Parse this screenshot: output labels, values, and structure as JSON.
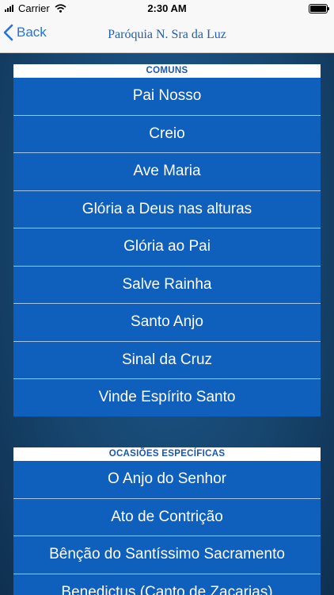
{
  "status_bar": {
    "carrier": "Carrier",
    "time": "2:30 AM"
  },
  "nav": {
    "back_label": "Back",
    "title": "Paróquia N. Sra da Luz"
  },
  "sections": [
    {
      "header": "COMUNS",
      "items": [
        "Pai Nosso",
        "Creio",
        "Ave Maria",
        "Glória a Deus nas alturas",
        "Glória ao Pai",
        "Salve Rainha",
        "Santo Anjo",
        "Sinal da Cruz",
        "Vinde Espírito Santo"
      ]
    },
    {
      "header": "OCASIÕES ESPECÍFICAS",
      "items": [
        "O Anjo do Senhor",
        "Ato de Contrição",
        "Bênção do Santíssimo Sacramento",
        "Benedictus (Canto de Zacarias)"
      ]
    }
  ]
}
